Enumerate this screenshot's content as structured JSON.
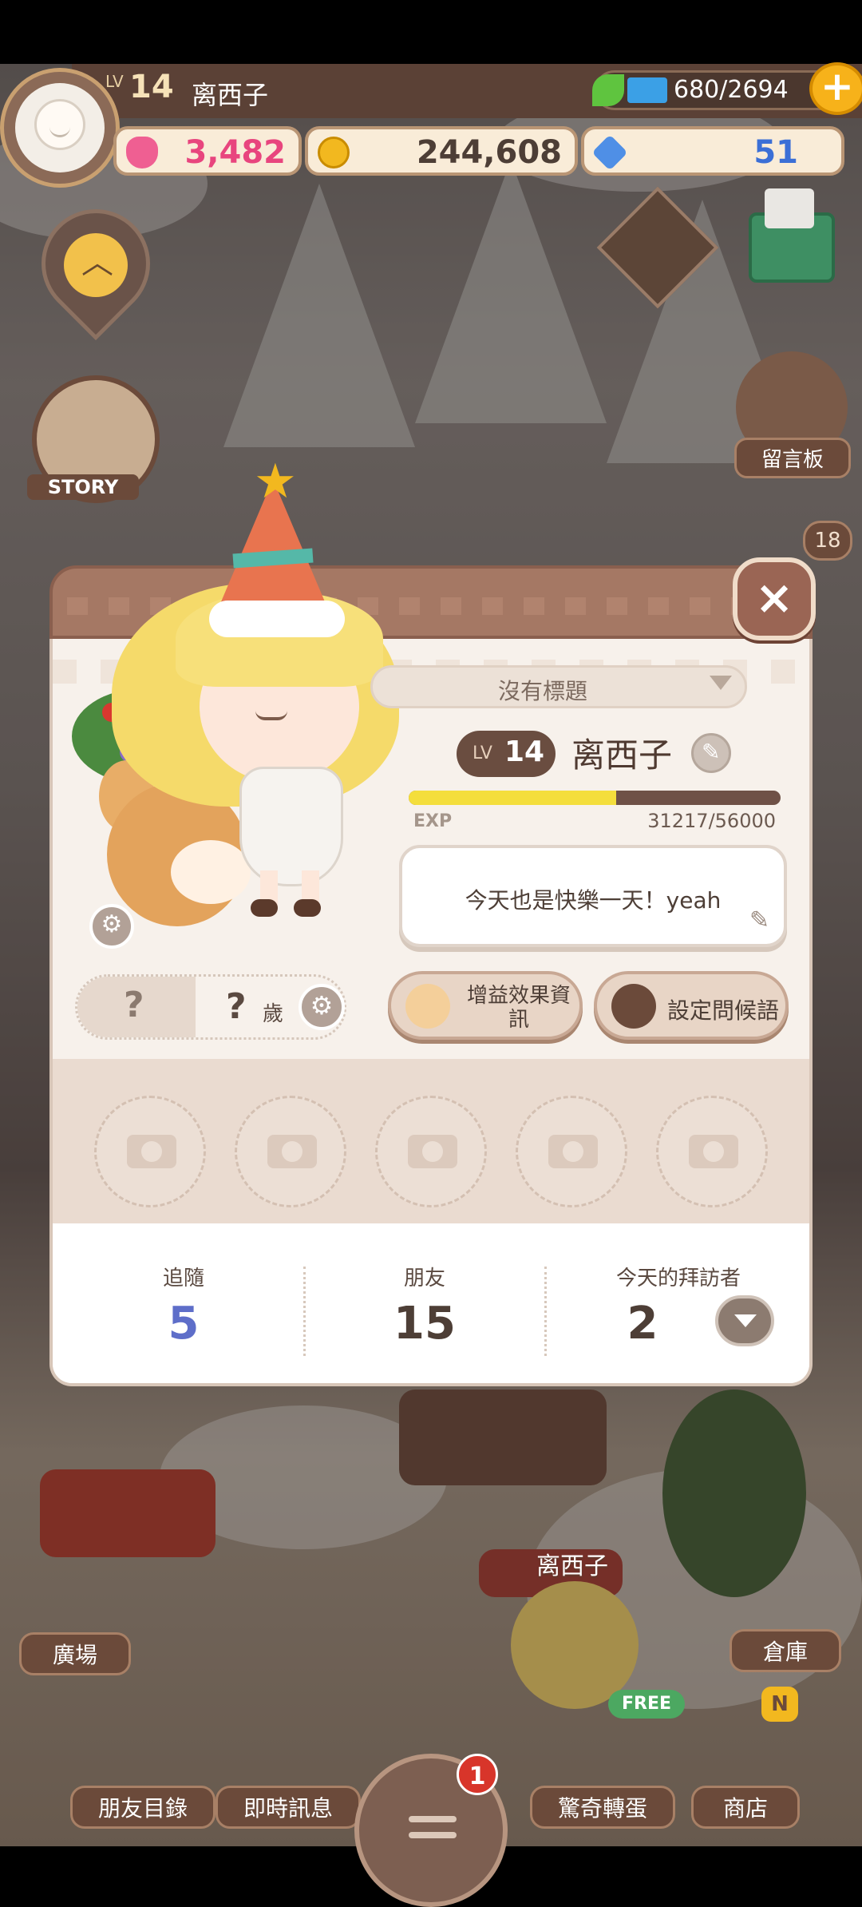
{
  "top_bar": {
    "level_prefix": "LV",
    "level": "14",
    "player_name": "离西子",
    "energy": "680/2694",
    "energy_fraction": 0.25,
    "hearts": "3,482",
    "gold": "244,608",
    "gems": "51",
    "add_label": "+"
  },
  "side": {
    "story_label": "STORY",
    "board_label": "留言板",
    "board_badge": "18"
  },
  "profile": {
    "close_label": "×",
    "title_dropdown": "沒有標題",
    "level_prefix": "LV",
    "level": "14",
    "name": "离西子",
    "exp_label": "EXP",
    "exp_value": "31217/56000",
    "exp_fraction": 0.557,
    "greeting": "今天也是快樂一天！yeah",
    "gender_unknown": "?",
    "age_unit": "歲",
    "buff_info_button": "增益效果資訊",
    "set_greeting_button": "設定問候語",
    "photo_slots": 5,
    "stats": [
      {
        "label": "追隨",
        "value": "5"
      },
      {
        "label": "朋友",
        "value": "15"
      },
      {
        "label": "今天的拜訪者",
        "value": "2"
      }
    ]
  },
  "colors": {
    "follow_number": "#5e6ec9",
    "stat_number": "#4d3e36",
    "heart_number": "#e8457e",
    "gold_number": "#4d3e36",
    "gem_number": "#3b6fd6"
  },
  "bottom": {
    "plaza_label": "廣場",
    "warehouse_label": "倉庫",
    "friend_list_label": "朋友目錄",
    "instant_msg_label": "即時訊息",
    "gacha_label": "驚奇轉蛋",
    "shop_label": "商店",
    "menu_badge": "1",
    "free_tag": "FREE",
    "new_tag": "N",
    "character_name": "离西子"
  }
}
